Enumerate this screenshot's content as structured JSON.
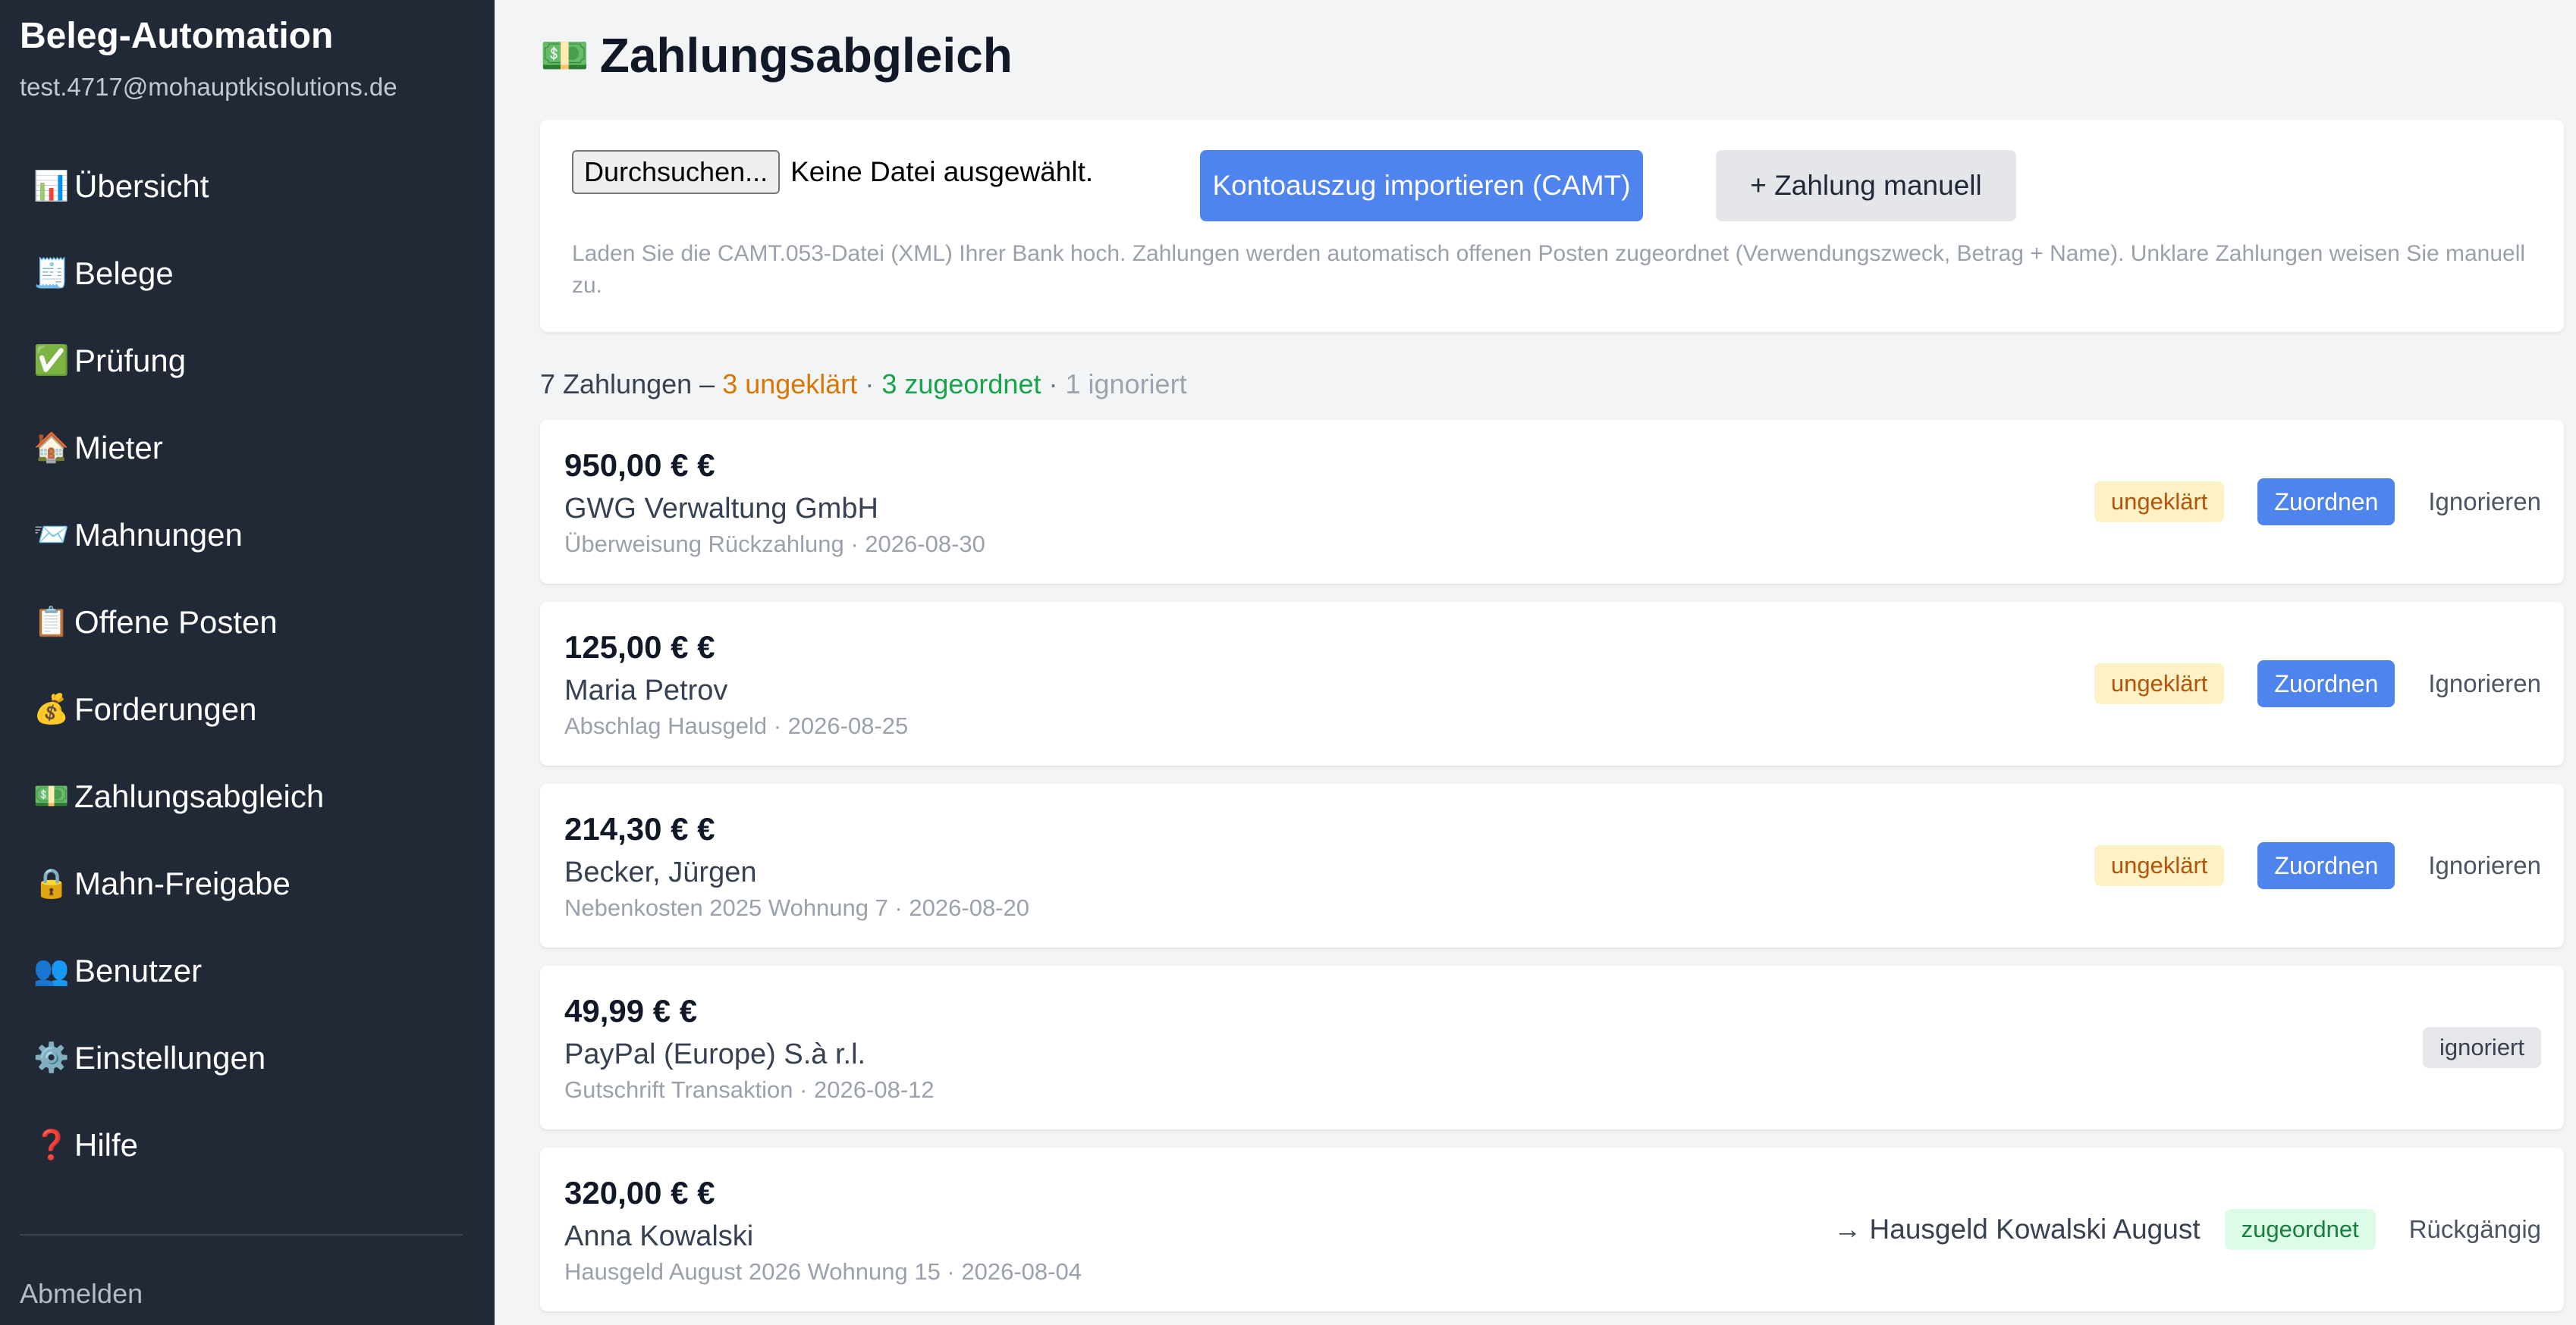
{
  "sidebar": {
    "title": "Beleg-Automation",
    "email": "test.4717@mohauptkisolutions.de",
    "items": [
      {
        "icon": "📊",
        "label": "Übersicht"
      },
      {
        "icon": "🧾",
        "label": "Belege"
      },
      {
        "icon": "✅",
        "label": "Prüfung"
      },
      {
        "icon": "🏠",
        "label": "Mieter"
      },
      {
        "icon": "📨",
        "label": "Mahnungen"
      },
      {
        "icon": "📋",
        "label": "Offene Posten"
      },
      {
        "icon": "💰",
        "label": "Forderungen"
      },
      {
        "icon": "💵",
        "label": "Zahlungsabgleich"
      },
      {
        "icon": "🔒",
        "label": "Mahn-Freigabe"
      },
      {
        "icon": "👥",
        "label": "Benutzer"
      },
      {
        "icon": "⚙️",
        "label": "Einstellungen"
      },
      {
        "icon": "❓",
        "label": "Hilfe"
      }
    ],
    "logout": "Abmelden"
  },
  "page": {
    "icon": "💵",
    "title": "Zahlungsabgleich"
  },
  "import": {
    "browse_label": "Durchsuchen...",
    "file_status": "Keine Datei ausgewählt.",
    "import_button": "Kontoauszug importieren (CAMT)",
    "manual_button": "+ Zahlung manuell",
    "help": "Laden Sie die CAMT.053-Datei (XML) Ihrer Bank hoch. Zahlungen werden automatisch offenen Posten zugeordnet (Verwendungszweck, Betrag + Name). Unklare Zahlungen weisen Sie manuell zu."
  },
  "summary": {
    "total": "7 Zahlungen – ",
    "unclear": "3 ungeklärt",
    "sep1": " · ",
    "assigned": "3 zugeordnet",
    "sep2": " · ",
    "ignored": "1 ignoriert"
  },
  "payments": [
    {
      "amount": "950,00 € €",
      "name": "GWG Verwaltung GmbH",
      "detail": "Überweisung Rückzahlung · 2026-08-30",
      "status": "ungeklärt",
      "assign": "Zuordnen",
      "ignore": "Ignorieren"
    },
    {
      "amount": "125,00 € €",
      "name": "Maria Petrov",
      "detail": "Abschlag Hausgeld · 2026-08-25",
      "status": "ungeklärt",
      "assign": "Zuordnen",
      "ignore": "Ignorieren"
    },
    {
      "amount": "214,30 € €",
      "name": "Becker, Jürgen",
      "detail": "Nebenkosten 2025 Wohnung 7 · 2026-08-20",
      "status": "ungeklärt",
      "assign": "Zuordnen",
      "ignore": "Ignorieren"
    },
    {
      "amount": "49,99 € €",
      "name": "PayPal (Europe) S.à r.l.",
      "detail": "Gutschrift Transaktion · 2026-08-12",
      "status": "ignoriert"
    },
    {
      "amount": "320,00 € €",
      "name": "Anna Kowalski",
      "detail": "Hausgeld August 2026 Wohnung 15 · 2026-08-04",
      "target": "→ Hausgeld Kowalski August",
      "status": "zugeordnet",
      "undo": "Rückgängig"
    }
  ]
}
